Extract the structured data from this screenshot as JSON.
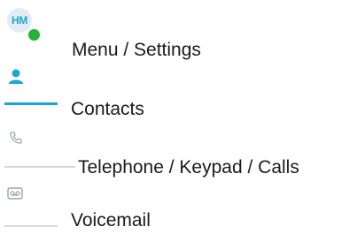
{
  "profile": {
    "initials": "HM",
    "presence_color": "#26b235",
    "label": "Menu / Settings"
  },
  "nav": {
    "contacts": {
      "label": "Contacts",
      "icon": "person-icon",
      "active": true,
      "accent": "#1aa6d6"
    },
    "calls": {
      "label": "Telephone / Keypad / Calls",
      "icon": "phone-icon"
    },
    "voicemail": {
      "label": "Voicemail",
      "icon": "voicemail-icon"
    }
  }
}
